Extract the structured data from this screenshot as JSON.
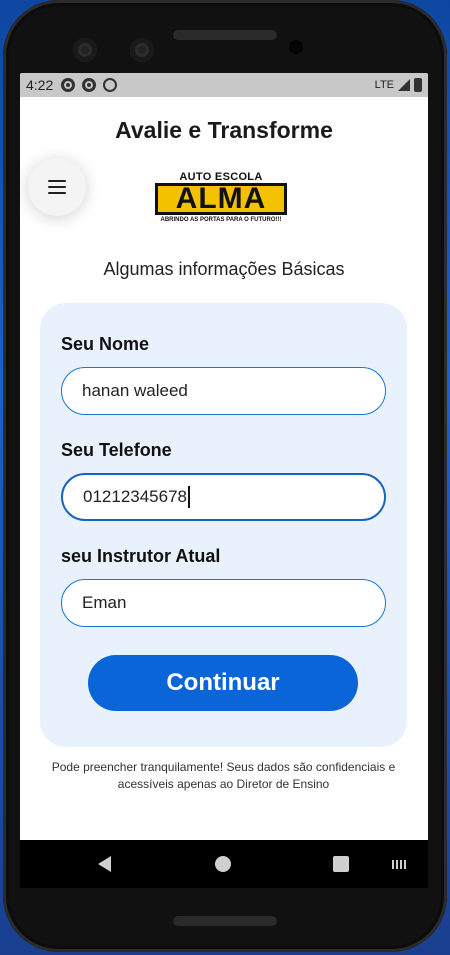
{
  "status_bar": {
    "time": "4:22",
    "network": "LTE"
  },
  "app": {
    "title": "Avalie e Transforme",
    "menu_icon": "hamburger-menu-icon",
    "logo": {
      "top_text": "AUTO ESCOLA",
      "brand": "ALMA",
      "tagline": "ABRINDO AS PORTAS PARA O FUTURO!!!",
      "brand_color": "#f2c200"
    },
    "subtitle": "Algumas informações Básicas"
  },
  "form": {
    "fields": [
      {
        "label": "Seu Nome",
        "value": "hanan waleed"
      },
      {
        "label": "Seu Telefone",
        "value": "01212345678"
      },
      {
        "label": "seu Instrutor Atual",
        "value": "Eman"
      }
    ],
    "submit_label": "Continuar",
    "accent_color": "#0a66d8",
    "card_color": "#e9f1fc"
  },
  "footer_note": "Pode preencher tranquilamente! Seus dados são confidenciais e acessíveis apenas ao Diretor de Ensino",
  "nav": {
    "back_icon": "back-triangle-icon",
    "home_icon": "home-circle-icon",
    "recents_icon": "recents-square-icon",
    "keyboard_icon": "keyboard-icon"
  }
}
